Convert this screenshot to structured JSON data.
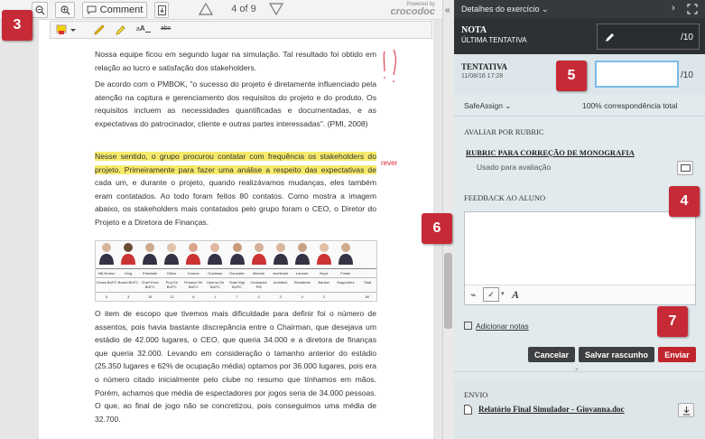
{
  "toolbar": {
    "comment_label": "Comment",
    "page_indicator": "4 of 9",
    "powered_by": "Powered by",
    "brand": "crocodoc"
  },
  "document": {
    "paragraphs": [
      "Nossa equipe ficou em segundo lugar na simulação. Tal resultado foi obtido em relação ao lucro e satisfação dos stakeholders.",
      "De acordo com o PMBOK, \"o sucesso do projeto é diretamente influenciado pela atenção na captura e gerenciamento dos requisitos do projeto e do produto. Os requisitos incluem as necessidades quantificadas e documentadas, e as expectativas do patrocinador, cliente e outras partes interessadas\". (PMI, 2008)"
    ],
    "highlighted_paragraph": "Nesse sentido, o grupo procurou contatar com frequência os stakeholders do projeto. Primeiramente para fazer uma análise a respeito das expectativas de",
    "paragraph3_rest": "cada um, e durante o projeto, quando realizávamos mudanças, eles também eram contatados. Ao todo foram feitos 80 contatos. Como mostra a imagem abaixo, os stakeholders mais contatados pelo grupo foram o CEO, o Diretor do Projeto e a Diretora de Finanças.",
    "paragraph4": "O item de escopo que tivemos mais dificuldade para definir foi o número de assentos, pois havia bastante discrepância entre o Chairman, que desejava um estádio de 42.000 lugares, o CEO, que queria 34.000 e a diretora de finanças que queria 32.000. Levando em consideração o tamanho anterior do estádio (25.350 lugares e 62% de ocupação média) optamos por 36.000 lugares, pois era o número citado inicialmente pelo clube no resumo que tínhamos em mãos. Porém, achamos que média de espectadores por jogos seria de 34.000 pessoas. O que, ao final de jogo não se concretizou, pois conseguimos uma média de 32.700.",
    "margin_comment": "rever",
    "stakeholder_names": [
      "Hill-Norton",
      "King",
      "Entwistle",
      "Dillon",
      "Connor",
      "Goldman",
      "Gonzalez",
      "Mercilo",
      "Archibald",
      "Lamont",
      "Boyd",
      "Foster",
      ""
    ],
    "stakeholder_roles": [
      "Chess BUFC",
      "Board BUFC",
      "Chief Exec BUFC",
      "Proj Dir BUFC",
      "Finance Dir BUFC",
      "Operns Dir BUFC",
      "Team Mgr BUFC",
      "Contractor PM",
      "Architect",
      "Residents",
      "Banker",
      "Supporters",
      "Total"
    ],
    "stakeholder_counts": [
      "5",
      "3",
      "15",
      "12",
      "6",
      "1",
      "7",
      "0",
      "3",
      "4",
      "2",
      "",
      "80"
    ]
  },
  "panel": {
    "header_title": "Detalhes do exercício",
    "nota_label": "NOTA",
    "nota_sub": "ÚLTIMA TENTATIVA",
    "nota_max": "/10",
    "tentativa_label": "TENTATIVA",
    "tentativa_date": "11/08/16 17:28",
    "tentativa_max": "/10",
    "safeassign": "SafeAssign",
    "match_text": "100% correspondência total",
    "avaliar_label": "AVALIAR POR RUBRIC",
    "rubric_title": "RUBRIC PARA CORREÇÃO DE MONOGRAFIA",
    "rubric_sub": "Usado para avaliação",
    "feedback_label": "FEEDBACK AO ALUNO",
    "add_notes": "Adicionar notas",
    "cancel_label": "Cancelar",
    "save_draft_label": "Salvar rascunho",
    "send_label": "Enviar",
    "envio_label": "ENVIO",
    "file_name": "Relatório Final Simulador - Giovanna.doc"
  },
  "badges": [
    "3",
    "4",
    "5",
    "6",
    "7"
  ],
  "colors": {
    "badge": "#c62a36",
    "highlight": "#f6ea6a",
    "dark_panel": "#2d3134",
    "send_button": "#c0252d",
    "button_dark": "#3d3f41"
  }
}
